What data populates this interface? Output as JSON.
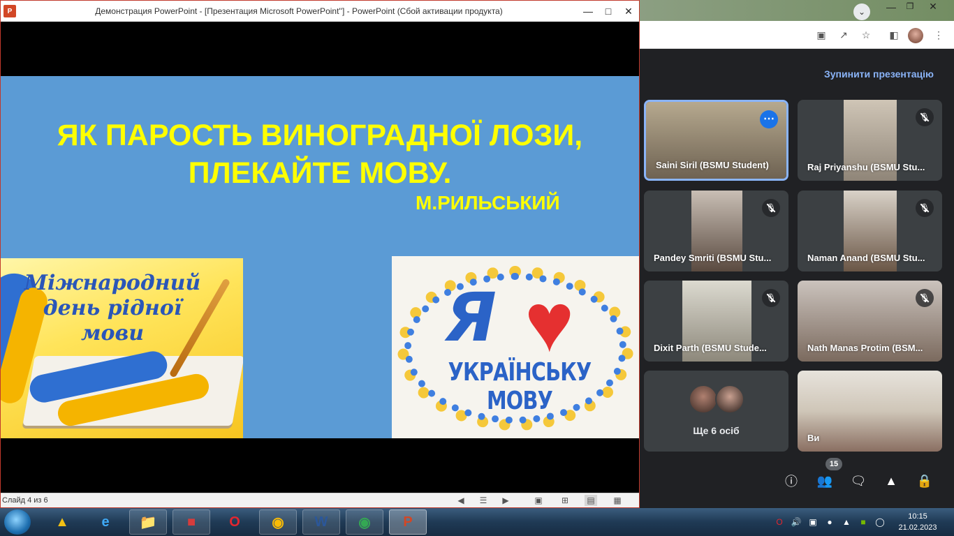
{
  "ppt": {
    "window_title": "Демонстрация PowerPoint - [Презентация Microsoft PowerPoint''] - PowerPoint (Сбой активации продукта)",
    "app_icon": "P",
    "slide": {
      "title_line1": "ЯК ПАРОСТЬ ВИНОГРАДНОЇ ЛОЗИ,",
      "title_line2": "ПЛЕКАЙТЕ МОВУ.",
      "author": "М.РИЛЬСЬКИЙ",
      "image_left_text": "Міжнародний день рідної мови",
      "image_right_letter": "Я",
      "image_right_text": "УКРАЇНСЬКУ МОВУ"
    },
    "status": {
      "slide_counter": "Слайд 4 из 6"
    }
  },
  "meet": {
    "stop_presenting": "Зупинити презентацію",
    "participants": [
      {
        "name": "Saini Siril (BSMU Student)",
        "active": true
      },
      {
        "name": "Raj Priyanshu (BSMU Stu..."
      },
      {
        "name": "Pandey Smriti (BSMU Stu..."
      },
      {
        "name": "Naman Anand (BSMU Stu..."
      },
      {
        "name": "Dixit Parth (BSMU Stude..."
      },
      {
        "name": "Nath Manas Protim (BSM..."
      }
    ],
    "others_label": "Ще 6 осіб",
    "self_label": "Ви",
    "people_count": "15"
  },
  "taskbar": {
    "time": "10:15",
    "date": "21.02.2023"
  },
  "colors": {
    "slide_bg": "#5b9bd5",
    "slide_text": "#ffff00",
    "meet_bg": "#202124",
    "meet_accent": "#8ab4f8"
  }
}
